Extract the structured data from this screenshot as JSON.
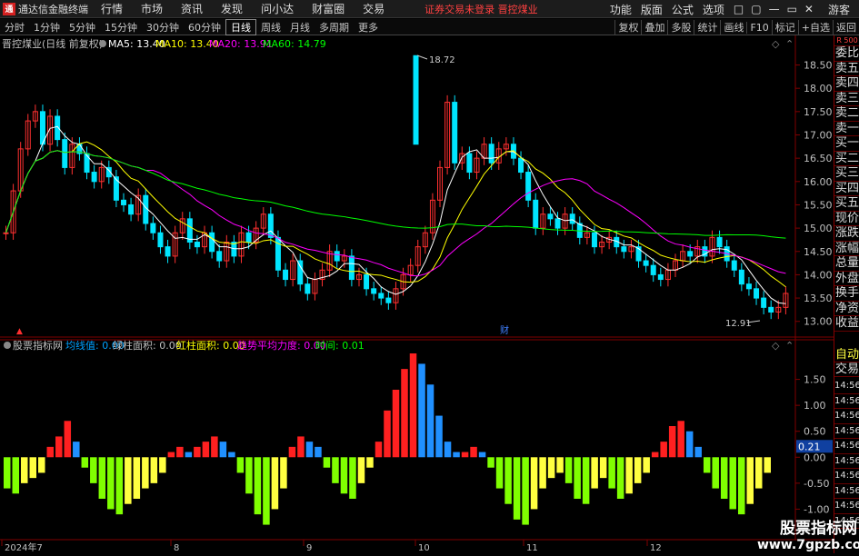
{
  "app": {
    "name": "通达信金融终端",
    "logo_text": "通"
  },
  "menu": [
    "行情",
    "市场",
    "资讯",
    "发现",
    "问小达",
    "财富圈",
    "交易"
  ],
  "notice": {
    "text": "证券交易未登录",
    "stock": "晋控煤业"
  },
  "right_menu": [
    "功能",
    "版面",
    "公式",
    "选项"
  ],
  "window_buttons": [
    "□",
    "▢",
    "—",
    "▭",
    "✕"
  ],
  "guest": "游客",
  "periods": [
    "分时",
    "1分钟",
    "5分钟",
    "15分钟",
    "30分钟",
    "60分钟",
    "日线",
    "周线",
    "月线",
    "多周期",
    "更多"
  ],
  "active_period": "日线",
  "toolbar_right": [
    "复权",
    "叠加",
    "多股",
    "统计",
    "画线",
    "F10",
    "标记",
    "+自选",
    "返回"
  ],
  "chart": {
    "title": "晋控煤业(日线 前复权)",
    "ma": [
      {
        "label": "MA5: 13.40",
        "color": "#ffffff"
      },
      {
        "label": "MA10: 13.40",
        "color": "#ffff00"
      },
      {
        "label": "MA20: 13.91",
        "color": "#ff00ff"
      },
      {
        "label": "MA60: 14.79",
        "color": "#00ff00"
      }
    ],
    "high_label": "18.72",
    "low_label": "12.91",
    "cai_label": "财",
    "y_ticks": [
      "18.50",
      "18.00",
      "17.50",
      "17.00",
      "16.50",
      "16.00",
      "15.50",
      "15.00",
      "14.50",
      "14.00",
      "13.50",
      "13.00"
    ],
    "ylim": [
      12.8,
      18.9
    ]
  },
  "indicator": {
    "name": "股票指标网",
    "params": [
      {
        "label": "均线值: 0.00",
        "color": "#00a0ff"
      },
      {
        "label": "绿柱面积: 0.00",
        "color": "#c0c0c0"
      },
      {
        "label": "红柱面积: 0.00",
        "color": "#ffff00"
      },
      {
        "label": "趋势平均力度: 0.00",
        "color": "#ff00ff"
      },
      {
        "label": "时间: 0.01",
        "color": "#00ff00"
      }
    ],
    "y_ticks": [
      "1.50",
      "1.00",
      "0.50",
      "0.21",
      "0.00",
      "-0.50",
      "-1.00"
    ],
    "ylim": [
      -1.5,
      2.0
    ]
  },
  "x_labels": [
    "2024年7",
    "8",
    "9",
    "10",
    "11",
    "12"
  ],
  "side_items": [
    "委比",
    "卖五",
    "卖四",
    "卖三",
    "卖二",
    "卖一",
    "买一",
    "买二",
    "买三",
    "买四",
    "买五",
    "现价",
    "涨跌",
    "涨幅",
    "总量",
    "外盘",
    "换手",
    "净资",
    "收益"
  ],
  "side_extra": [
    "自动",
    "交易"
  ],
  "side_times": [
    "14:56",
    "14:56",
    "14:56",
    "14:56",
    "14:56",
    "14:56",
    "14:56",
    "14:56",
    "14:56",
    "14:56"
  ],
  "side_top": "R 500",
  "watermark": {
    "line1": "股票指标网",
    "line2": "www.7gpzb.com"
  }
}
